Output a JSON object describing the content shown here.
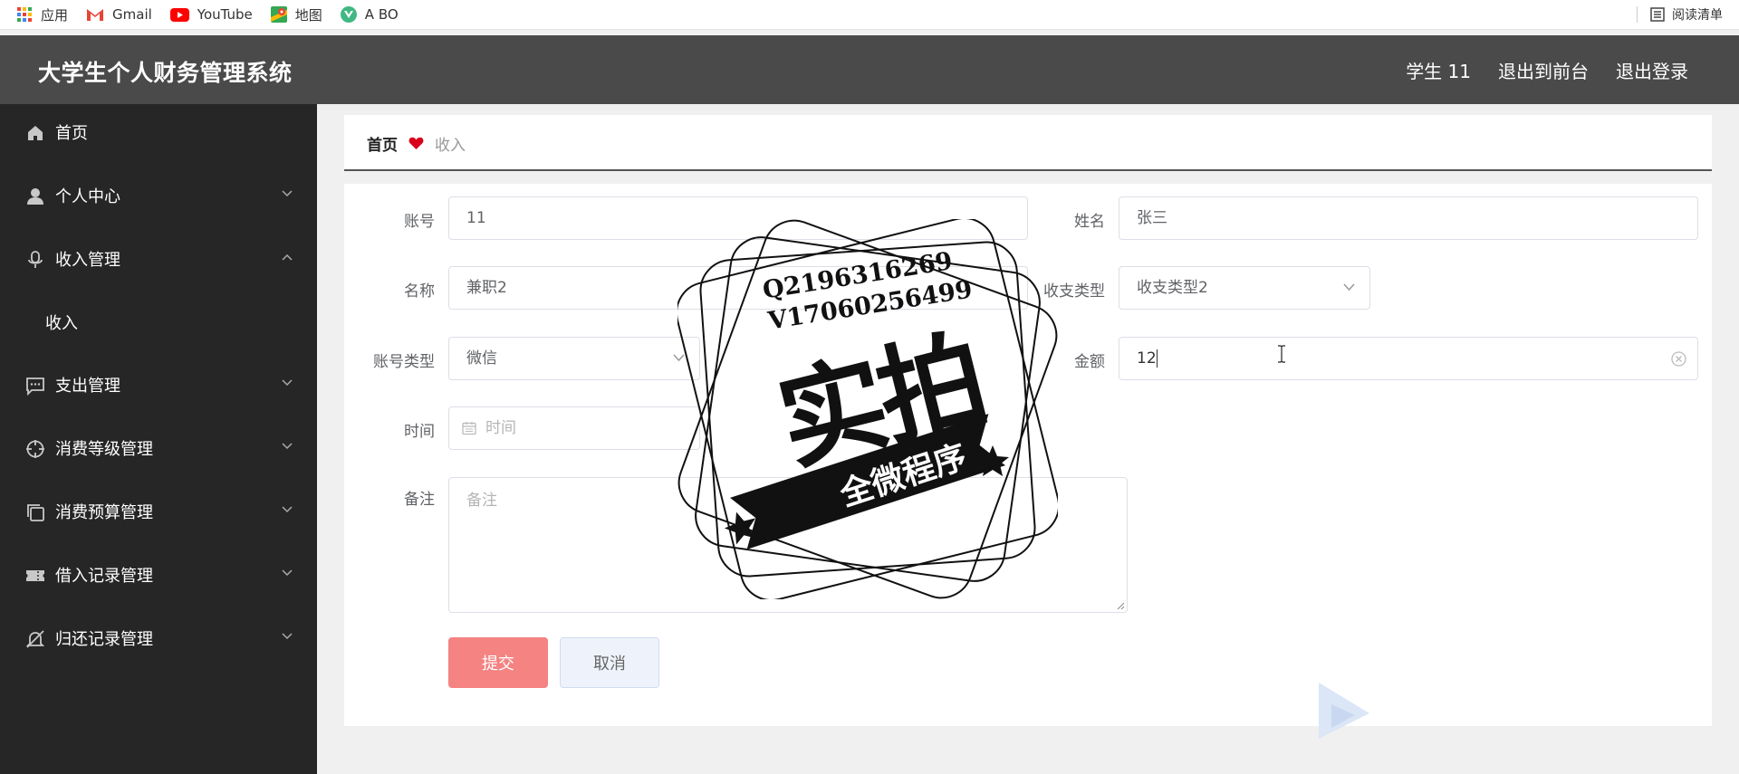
{
  "bookmarks": {
    "apps": "应用",
    "gmail": "Gmail",
    "youtube": "YouTube",
    "maps": "地图",
    "abo": "A BO",
    "reading_list": "阅读清单"
  },
  "header": {
    "title": "大学生个人财务管理系统",
    "user": "学生 11",
    "exit_front": "退出到前台",
    "logout": "退出登录"
  },
  "sidebar": {
    "items": [
      {
        "label": "首页",
        "icon": "home-icon"
      },
      {
        "label": "个人中心",
        "icon": "user-icon"
      },
      {
        "label": "收入管理",
        "icon": "microphone-icon"
      },
      {
        "label": "支出管理",
        "icon": "chat-icon"
      },
      {
        "label": "消费等级管理",
        "icon": "target-icon"
      },
      {
        "label": "消费预算管理",
        "icon": "copy-icon"
      },
      {
        "label": "借入记录管理",
        "icon": "ticket-icon"
      },
      {
        "label": "归还记录管理",
        "icon": "bell-off-icon"
      }
    ],
    "sub_income": "收入"
  },
  "breadcrumb": {
    "home": "首页",
    "current": "收入"
  },
  "form": {
    "account_label": "账号",
    "account_value": "11",
    "name_label": "姓名",
    "name_value": "张三",
    "title_label": "名称",
    "title_value": "兼职2",
    "type_label": "收支类型",
    "type_value": "收支类型2",
    "account_type_label": "账号类型",
    "account_type_value": "微信",
    "amount_label": "金额",
    "amount_value": "12",
    "time_label": "时间",
    "time_placeholder": "时间",
    "remark_label": "备注",
    "remark_placeholder": "备注",
    "submit_label": "提交",
    "cancel_label": "取消"
  },
  "stamp": {
    "line1": "Q2196316269",
    "line2": "V17060256499",
    "main": "实拍",
    "banner": "全微程序"
  },
  "colors": {
    "header_bg": "#4a4a4a",
    "sidebar_bg": "#262626",
    "submit_bg": "#f48382",
    "heart": "#d9001b"
  }
}
